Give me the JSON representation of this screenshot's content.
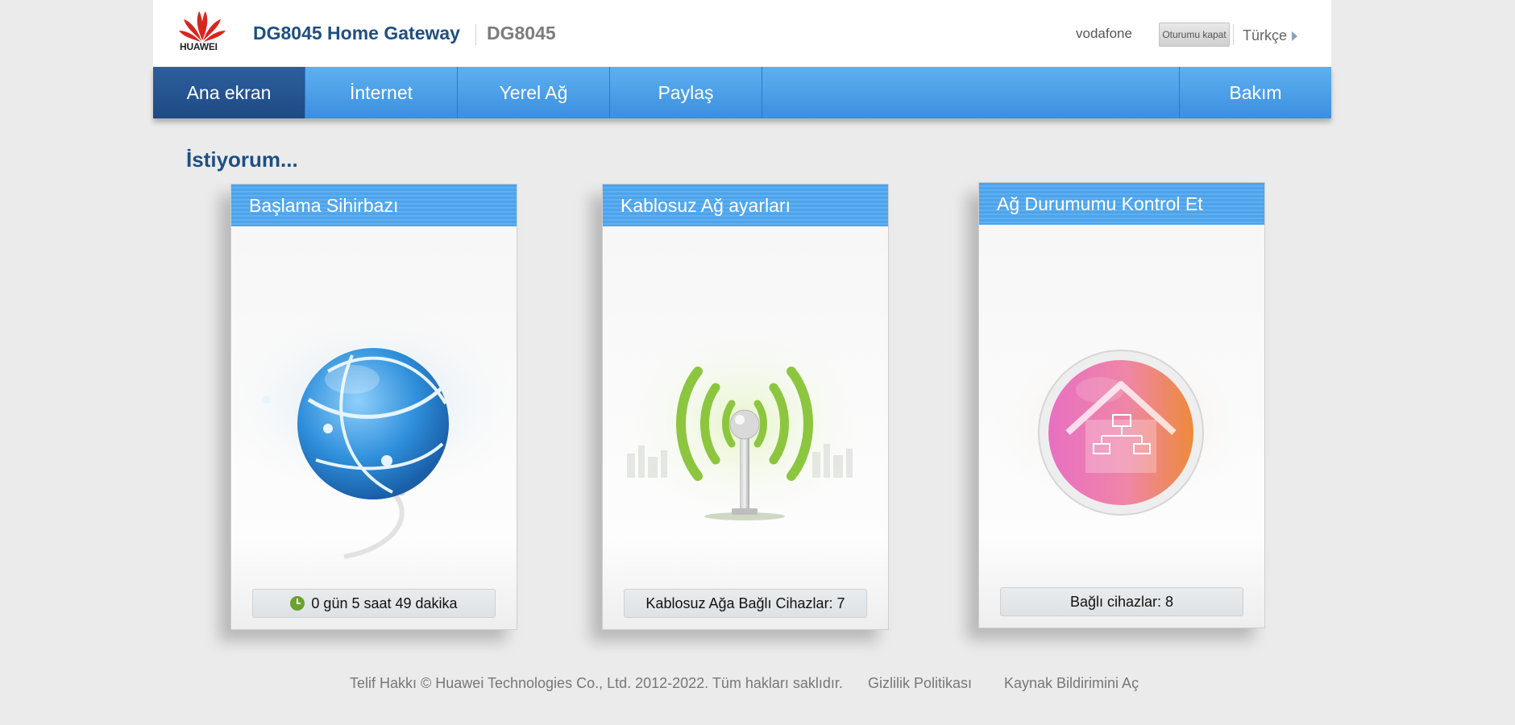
{
  "header": {
    "logo_text": "HUAWEI",
    "title": "DG8045 Home Gateway",
    "model": "DG8045",
    "user": "vodafone",
    "logout_label": "Oturumu kapat",
    "language": "Türkçe"
  },
  "nav": {
    "items": [
      {
        "label": "Ana ekran",
        "active": true
      },
      {
        "label": "İnternet"
      },
      {
        "label": "Yerel Ağ"
      },
      {
        "label": "Paylaş"
      },
      {
        "label": "Bakım"
      }
    ]
  },
  "main": {
    "section_title": "İstiyorum...",
    "cards": [
      {
        "title": "Başlama Sihirbazı",
        "footer": "0 gün 5 saat 49 dakika",
        "icon": "globe-icon"
      },
      {
        "title": "Kablosuz Ağ ayarları",
        "footer": "Kablosuz Ağa Bağlı Cihazlar: 7",
        "icon": "wifi-antenna-icon"
      },
      {
        "title": "Ağ Durumumu Kontrol Et",
        "footer": "Bağlı cihazlar: 8",
        "icon": "home-network-icon"
      }
    ]
  },
  "footer": {
    "copyright": "Telif Hakkı © Huawei Technologies Co., Ltd. 2012-2022. Tüm hakları saklıdır.",
    "privacy": "Gizlilik Politikası",
    "opensource": "Kaynak Bildirimini Aç"
  },
  "colors": {
    "brand": "#1f4f82",
    "nav": "#3b8fdf",
    "nav_active": "#1e4a84",
    "uptime_icon": "#6aa22c"
  }
}
